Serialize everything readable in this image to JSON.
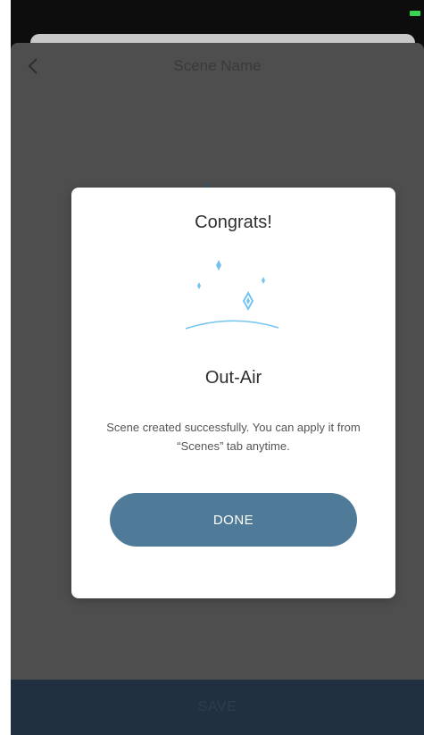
{
  "header": {
    "title": "Scene Name",
    "back_icon": "chevron-left-icon"
  },
  "dialog": {
    "title": "Congrats!",
    "illustration_icon": "sparkles-icon",
    "scene_name": "Out-Air",
    "message": "Scene created successfully. You can apply it from “Scenes” tab anytime.",
    "done_label": "DONE"
  },
  "footer": {
    "save_label": "SAVE"
  },
  "colors": {
    "accent": "#4f7a98",
    "sparkle": "#74c4f0",
    "overlay": "#4e4e4e",
    "save_bar": "#213040"
  }
}
